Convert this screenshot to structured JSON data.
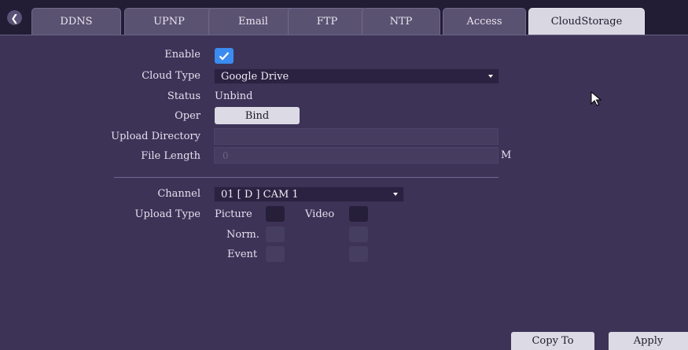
{
  "tabs": [
    "DDNS",
    "UPNP",
    "Email",
    "FTP",
    "NTP",
    "Access",
    "CloudStorage"
  ],
  "active_tab": "CloudStorage",
  "form": {
    "enable_label": "Enable",
    "enable_checked": true,
    "cloud_type_label": "Cloud Type",
    "cloud_type_value": "Google Drive",
    "status_label": "Status",
    "status_value": "Unbind",
    "oper_label": "Oper",
    "bind_button": "Bind",
    "upload_directory_label": "Upload Directory",
    "upload_directory_value": "",
    "file_length_label": "File Length",
    "file_length_value": "0",
    "file_length_unit": "M",
    "channel_label": "Channel",
    "channel_value": "01 [ D ] CAM 1",
    "upload_type_label": "Upload Type",
    "picture_label": "Picture",
    "video_label": "Video",
    "norm_label": "Norm.",
    "event_label": "Event"
  },
  "footer": {
    "copy_to_button": "Copy To",
    "apply_button": "Apply"
  },
  "colors": {
    "background": "#3c3357",
    "tabbar": "#221c34",
    "accent_check": "#3a8cf0",
    "active_tab": "#d9d7e2"
  }
}
